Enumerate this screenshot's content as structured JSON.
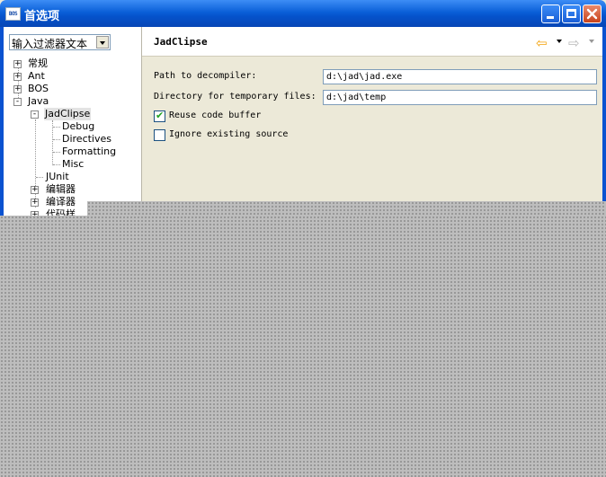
{
  "window": {
    "title": "首选项",
    "app_icon_text": "BOS",
    "controls": [
      "minimize",
      "maximize",
      "close"
    ]
  },
  "filter": {
    "value": "输入过滤器文本"
  },
  "tree": {
    "items": [
      {
        "label": "常规",
        "toggle": "+"
      },
      {
        "label": "Ant",
        "toggle": "+"
      },
      {
        "label": "BOS",
        "toggle": "+"
      },
      {
        "label": "Java",
        "toggle": "-"
      },
      {
        "label": "JadClipse",
        "toggle": "-",
        "selected": true
      },
      {
        "label": "Debug"
      },
      {
        "label": "Directives"
      },
      {
        "label": "Formatting"
      },
      {
        "label": "Misc"
      },
      {
        "label": "JUnit"
      },
      {
        "label": "编辑器",
        "toggle": "+"
      },
      {
        "label": "编译器",
        "toggle": "+"
      },
      {
        "label": "代码样",
        "toggle": "+"
      }
    ]
  },
  "page": {
    "title": "JadClipse",
    "nav": {
      "back_icon": "back-arrow-icon",
      "forward_icon": "forward-arrow-icon"
    },
    "fields": [
      {
        "label": "Path to decompiler:",
        "value": "d:\\jad\\jad.exe"
      },
      {
        "label": "Directory for temporary files:",
        "value": "d:\\jad\\temp"
      }
    ],
    "checkboxes": [
      {
        "label": "Reuse code buffer",
        "checked": true
      },
      {
        "label": "Ignore existing source",
        "checked": false
      }
    ]
  },
  "colors": {
    "titlebar": "#0a5fd8",
    "background": "#ece9d8",
    "back_arrow": "#f3a20b"
  }
}
